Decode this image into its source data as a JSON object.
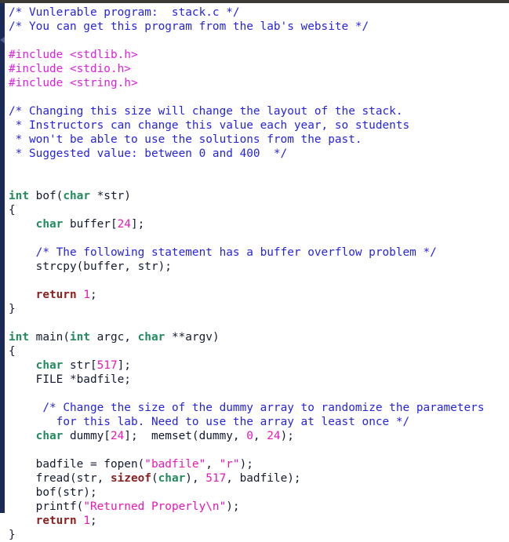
{
  "window": {
    "title": "stack.c",
    "background_color": "#ffffff",
    "top_strip_color": "#3b3a35",
    "gutter_color": "#1b2a56"
  },
  "palette": {
    "comment": "#2525e0",
    "preprocessor": "#e020e0",
    "type_keyword": "#218b5e",
    "control_keyword": "#8a2020",
    "number": "#e817b8",
    "string": "#e817b8",
    "plain_text": "#151a33"
  },
  "editor": {
    "language": "c",
    "font_size_px": 14.4,
    "line_height_px": 18,
    "marker": "caret-marker"
  },
  "code": {
    "lines": [
      [
        {
          "t": "comment",
          "s": "/* Vunlerable program:  stack.c */"
        }
      ],
      [
        {
          "t": "comment",
          "s": "/* You can get this program from the lab's website */"
        }
      ],
      [],
      [
        {
          "t": "pre",
          "s": "#include <stdlib.h>"
        }
      ],
      [
        {
          "t": "pre",
          "s": "#include <stdio.h>"
        }
      ],
      [
        {
          "t": "pre",
          "s": "#include <string.h>"
        }
      ],
      [],
      [
        {
          "t": "comment",
          "s": "/* Changing this size will change the layout of the stack."
        }
      ],
      [
        {
          "t": "comment",
          "s": " * Instructors can change this value each year, so students"
        }
      ],
      [
        {
          "t": "comment",
          "s": " * won't be able to use the solutions from the past."
        }
      ],
      [
        {
          "t": "comment",
          "s": " * Suggested value: between 0 and 400  */"
        }
      ],
      [],
      [],
      [
        {
          "t": "type",
          "s": "int"
        },
        {
          "t": "plain",
          "s": " bof("
        },
        {
          "t": "type",
          "s": "char"
        },
        {
          "t": "plain",
          "s": " *str)"
        }
      ],
      [
        {
          "t": "plain",
          "s": "{"
        }
      ],
      [
        {
          "t": "plain",
          "s": "    "
        },
        {
          "t": "type",
          "s": "char"
        },
        {
          "t": "plain",
          "s": " buffer["
        },
        {
          "t": "num",
          "s": "24"
        },
        {
          "t": "plain",
          "s": "];"
        }
      ],
      [],
      [
        {
          "t": "plain",
          "s": "    "
        },
        {
          "t": "comment",
          "s": "/* The following statement has a buffer overflow problem */"
        }
      ],
      [
        {
          "t": "plain",
          "s": "    strcpy(buffer, str);"
        }
      ],
      [],
      [
        {
          "t": "plain",
          "s": "    "
        },
        {
          "t": "kw",
          "s": "return"
        },
        {
          "t": "plain",
          "s": " "
        },
        {
          "t": "num",
          "s": "1"
        },
        {
          "t": "plain",
          "s": ";"
        }
      ],
      [
        {
          "t": "plain",
          "s": "}"
        }
      ],
      [],
      [
        {
          "t": "type",
          "s": "int"
        },
        {
          "t": "plain",
          "s": " main("
        },
        {
          "t": "type",
          "s": "int"
        },
        {
          "t": "plain",
          "s": " argc, "
        },
        {
          "t": "type",
          "s": "char"
        },
        {
          "t": "plain",
          "s": " **argv)"
        }
      ],
      [
        {
          "t": "plain",
          "s": "{"
        }
      ],
      [
        {
          "t": "plain",
          "s": "    "
        },
        {
          "t": "type",
          "s": "char"
        },
        {
          "t": "plain",
          "s": " str["
        },
        {
          "t": "num",
          "s": "517"
        },
        {
          "t": "plain",
          "s": "];"
        }
      ],
      [
        {
          "t": "plain",
          "s": "    FILE *badfile;"
        }
      ],
      [],
      [
        {
          "t": "plain",
          "s": "     "
        },
        {
          "t": "comment",
          "s": "/* Change the size of the dummy array to randomize the parameters"
        }
      ],
      [
        {
          "t": "plain",
          "s": "       "
        },
        {
          "t": "comment",
          "s": "for this lab. Need to use the array at least once */"
        }
      ],
      [
        {
          "t": "plain",
          "s": "    "
        },
        {
          "t": "type",
          "s": "char"
        },
        {
          "t": "plain",
          "s": " dummy["
        },
        {
          "t": "num",
          "s": "24"
        },
        {
          "t": "plain",
          "s": "];  memset(dummy, "
        },
        {
          "t": "num",
          "s": "0"
        },
        {
          "t": "plain",
          "s": ", "
        },
        {
          "t": "num",
          "s": "24"
        },
        {
          "t": "plain",
          "s": ");"
        }
      ],
      [],
      [
        {
          "t": "plain",
          "s": "    badfile = fopen("
        },
        {
          "t": "str",
          "s": "\"badfile\""
        },
        {
          "t": "plain",
          "s": ", "
        },
        {
          "t": "str",
          "s": "\"r\""
        },
        {
          "t": "plain",
          "s": ");"
        }
      ],
      [
        {
          "t": "plain",
          "s": "    fread(str, "
        },
        {
          "t": "kw",
          "s": "sizeof"
        },
        {
          "t": "plain",
          "s": "("
        },
        {
          "t": "type",
          "s": "char"
        },
        {
          "t": "plain",
          "s": "), "
        },
        {
          "t": "num",
          "s": "517"
        },
        {
          "t": "plain",
          "s": ", badfile);"
        }
      ],
      [
        {
          "t": "plain",
          "s": "    bof(str);"
        }
      ],
      [
        {
          "t": "plain",
          "s": "    printf("
        },
        {
          "t": "str",
          "s": "\"Returned Properly\\n\""
        },
        {
          "t": "plain",
          "s": ");"
        }
      ],
      [
        {
          "t": "plain",
          "s": "    "
        },
        {
          "t": "kw",
          "s": "return"
        },
        {
          "t": "plain",
          "s": " "
        },
        {
          "t": "num",
          "s": "1"
        },
        {
          "t": "plain",
          "s": ";"
        }
      ],
      [
        {
          "t": "plain",
          "s": "}"
        }
      ]
    ]
  }
}
